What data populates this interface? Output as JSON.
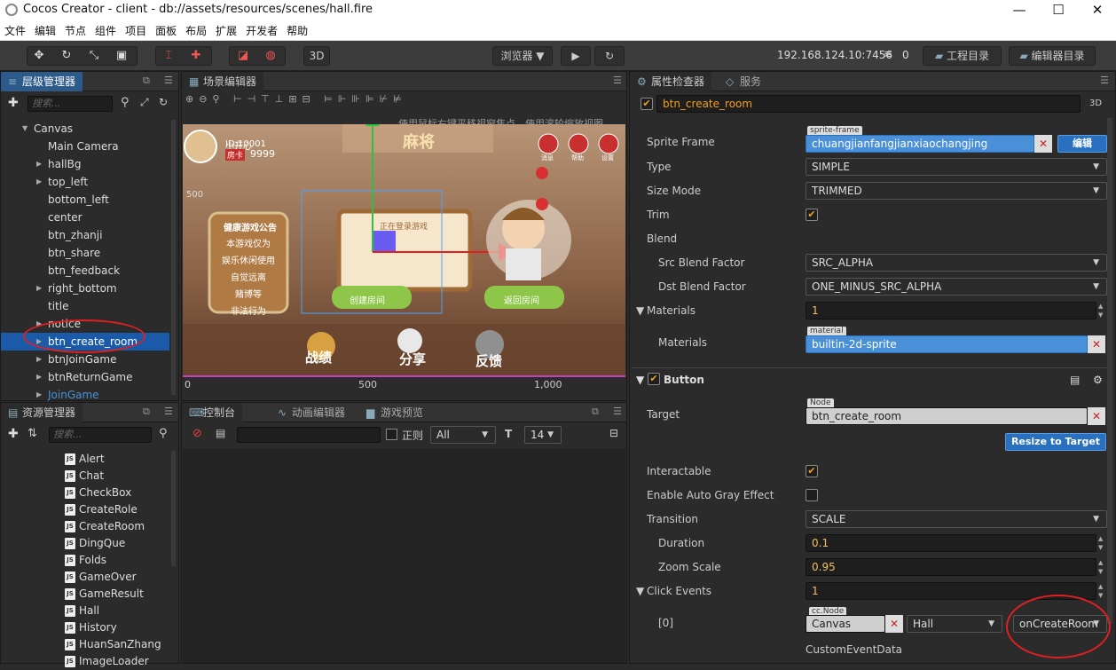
{
  "window": {
    "title": "Cocos Creator - client - db://assets/resources/scenes/hall.fire",
    "minimize": "—",
    "maximize": "☐",
    "close": "✕"
  },
  "menu": [
    "文件",
    "编辑",
    "节点",
    "组件",
    "项目",
    "面板",
    "布局",
    "扩展",
    "开发者",
    "帮助"
  ],
  "toolbar": {
    "mode_3d": "3D",
    "browser": "浏览器",
    "ip": "192.168.124.10:7456",
    "conn_count": "0",
    "project_dir": "工程目录",
    "editor_dir": "编辑器目录"
  },
  "hierarchy": {
    "title": "层级管理器",
    "search_placeholder": "搜索...",
    "root": "Canvas",
    "items": [
      {
        "label": "Main Camera",
        "arrow": false
      },
      {
        "label": "hallBg",
        "arrow": true
      },
      {
        "label": "top_left",
        "arrow": true
      },
      {
        "label": "bottom_left",
        "arrow": false
      },
      {
        "label": "center",
        "arrow": false
      },
      {
        "label": "btn_zhanji",
        "arrow": false
      },
      {
        "label": "btn_share",
        "arrow": false
      },
      {
        "label": "btn_feedback",
        "arrow": false
      },
      {
        "label": "right_bottom",
        "arrow": true
      },
      {
        "label": "title",
        "arrow": false
      },
      {
        "label": "notice",
        "arrow": true
      },
      {
        "label": "btn_create_room",
        "arrow": true,
        "selected": true
      },
      {
        "label": "btnJoinGame",
        "arrow": true
      },
      {
        "label": "btnReturnGame",
        "arrow": true
      },
      {
        "label": "JoinGame",
        "arrow": true,
        "prefab": true
      }
    ]
  },
  "scene_editor": {
    "title": "场景编辑器",
    "hint": "使用鼠标右键平移视窗焦点，使用滚轮缩放视图",
    "ruler": [
      "0",
      "500",
      "1,000"
    ],
    "ruler_left": "500",
    "game": {
      "player_name": "小开心",
      "player_id": "ID:10001",
      "card_label": "房卡",
      "card_count": "9999",
      "logo": "麻将",
      "btn_msg": "消息",
      "btn_help": "帮助",
      "btn_settings": "设置",
      "notice_title": "健康游戏公告",
      "notice_lines": [
        "本游戏仅为",
        "娱乐休闲使用",
        "自觉远离",
        "赌博等",
        "非法行为"
      ],
      "board_text": "正在登录游戏",
      "btn_create": "创建房间",
      "btn_return": "返回房间",
      "bottom_zhanji": "战绩",
      "bottom_share": "分享",
      "bottom_feedback": "反馈"
    }
  },
  "assets": {
    "title": "资源管理器",
    "search_placeholder": "搜索...",
    "items": [
      "Alert",
      "Chat",
      "CheckBox",
      "CreateRole",
      "CreateRoom",
      "DingQue",
      "Folds",
      "GameOver",
      "GameResult",
      "Hall",
      "History",
      "HuanSanZhang",
      "ImageLoader"
    ]
  },
  "console": {
    "tab_console": "控制台",
    "tab_anim": "动画编辑器",
    "tab_preview": "游戏预览",
    "regex_label": "正则",
    "level": "All",
    "font_size": "14"
  },
  "inspector": {
    "tab_props": "属性检查器",
    "tab_services": "服务",
    "node_name": "btn_create_room",
    "mode_3d": "3D",
    "sprite": {
      "sprite_frame_label": "Sprite Frame",
      "sprite_frame_tag": "sprite-frame",
      "sprite_frame_value": "chuangjianfangjianxiaochangjing",
      "edit_button": "编辑",
      "type_label": "Type",
      "type_value": "SIMPLE",
      "size_mode_label": "Size Mode",
      "size_mode_value": "TRIMMED",
      "trim_label": "Trim",
      "trim_checked": true,
      "blend_label": "Blend",
      "src_blend_label": "Src Blend Factor",
      "src_blend_value": "SRC_ALPHA",
      "dst_blend_label": "Dst Blend Factor",
      "dst_blend_value": "ONE_MINUS_SRC_ALPHA",
      "materials_label": "Materials",
      "materials_count": "1",
      "materials_item_label": "Materials",
      "material_tag": "material",
      "material_value": "builtin-2d-sprite"
    },
    "button": {
      "section": "Button",
      "target_label": "Target",
      "target_tag": "Node",
      "target_value": "btn_create_room",
      "resize_button": "Resize to Target",
      "interactable_label": "Interactable",
      "interactable_checked": true,
      "auto_gray_label": "Enable Auto Gray Effect",
      "auto_gray_checked": false,
      "transition_label": "Transition",
      "transition_value": "SCALE",
      "duration_label": "Duration",
      "duration_value": "0.1",
      "zoom_label": "Zoom Scale",
      "zoom_value": "0.95",
      "click_events_label": "Click Events",
      "click_events_count": "1",
      "event_index": "[0]",
      "event_tag": "cc.Node",
      "event_node": "Canvas",
      "event_component": "Hall",
      "event_handler": "onCreateRoom",
      "custom_label": "CustomEventData"
    }
  }
}
